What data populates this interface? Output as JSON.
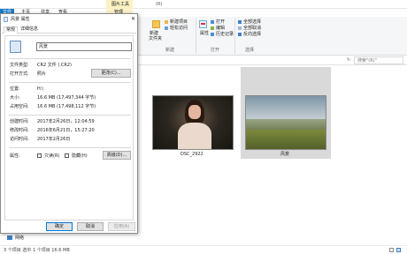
{
  "explorer": {
    "tabs": {
      "file": "文件",
      "home": "主页",
      "share": "共享",
      "view": "查看",
      "manage": "管理"
    },
    "contextual_header": "图片工具",
    "window_title": "(R)",
    "ribbon": {
      "new_group": {
        "new_item": "新建项目",
        "easy_access": "轻松访问",
        "new_folder_1": "新建",
        "new_folder_2": "文件夹",
        "label": "新建"
      },
      "open_group": {
        "open": "打开",
        "edit": "编辑",
        "history": "历史记录",
        "properties_1": "属性",
        "label": "打开"
      },
      "select_group": {
        "select_all": "全部选择",
        "select_none": "全部取消",
        "invert": "反向选择",
        "label": "选择"
      }
    },
    "search_placeholder": "搜索\"(R)\"",
    "files": [
      {
        "name": "DSC_2922"
      },
      {
        "name": "风景"
      }
    ],
    "nav_item": "网络",
    "status": "3 个项目    选中 1 个项目  16.6 MB"
  },
  "dialog": {
    "title": "风景 属性",
    "tabs": {
      "general": "常规",
      "details": "详细信息"
    },
    "file_name": "风景",
    "type_label": "文件类型:",
    "type_value": "CR2 文件 (.CR2)",
    "open_with_label": "打开方式:",
    "open_with_value": "照片",
    "change_button": "更改(C)...",
    "location_label": "位置:",
    "location_value": "H:\\",
    "size_label": "大小:",
    "size_value": "16.6 MB (17,497,344 字节)",
    "size_on_disk_label": "占用空间:",
    "size_on_disk_value": "16.6 MB (17,498,112 字节)",
    "created_label": "创建时间:",
    "created_value": "2017年2月26日，12:04:59",
    "modified_label": "修改时间:",
    "modified_value": "2016年6月21日，15:27:20",
    "accessed_label": "访问时间:",
    "accessed_value": "2017年2月26日",
    "attributes_label": "属性:",
    "readonly_label": "只读(R)",
    "hidden_label": "隐藏(H)",
    "advanced_button": "高级(D)...",
    "ok": "确定",
    "cancel": "取消",
    "apply": "应用(A)"
  }
}
